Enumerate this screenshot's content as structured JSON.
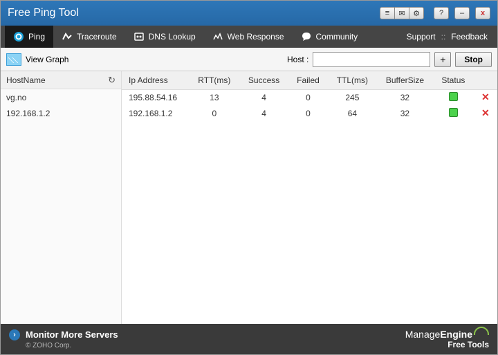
{
  "title": "Free Ping Tool",
  "titlebar_buttons": {
    "list": "≡",
    "mail": "✉",
    "gear": "⚙",
    "help": "?",
    "min": "–",
    "close": "x"
  },
  "menu": {
    "ping": "Ping",
    "traceroute": "Traceroute",
    "dns": "DNS Lookup",
    "web": "Web Response",
    "community": "Community",
    "support": "Support",
    "sep": "::",
    "feedback": "Feedback"
  },
  "toolbar": {
    "view_graph": "View Graph",
    "host_label": "Host  :",
    "host_value": "",
    "add": "+",
    "stop": "Stop"
  },
  "left": {
    "header": "HostName",
    "rows": [
      "vg.no",
      "192.168.1.2"
    ]
  },
  "table": {
    "headers": {
      "ip": "Ip Address",
      "rtt": "RTT(ms)",
      "success": "Success",
      "failed": "Failed",
      "ttl": "TTL(ms)",
      "buf": "BufferSize",
      "status": "Status"
    },
    "rows": [
      {
        "ip": "195.88.54.16",
        "rtt": "13",
        "success": "4",
        "failed": "0",
        "ttl": "245",
        "buf": "32"
      },
      {
        "ip": "192.168.1.2",
        "rtt": "0",
        "success": "4",
        "failed": "0",
        "ttl": "64",
        "buf": "32"
      }
    ]
  },
  "footer": {
    "monitor": "Monitor More Servers",
    "copyright": "© ZOHO Corp.",
    "brand1a": "Manage",
    "brand1b": "Engine",
    "brand2": "Free Tools"
  }
}
